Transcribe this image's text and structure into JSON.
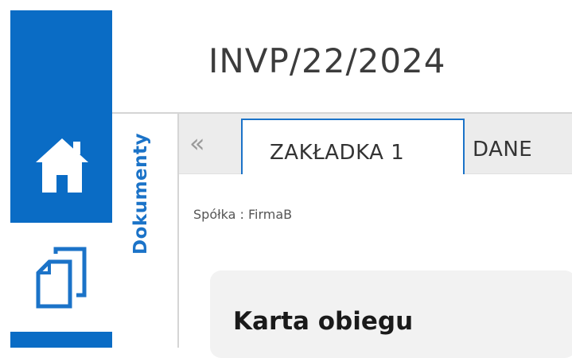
{
  "header": {
    "title": "INVP/22/2024"
  },
  "sidebar": {
    "items": [
      {
        "icon": "home-icon"
      },
      {
        "icon": "documents-icon"
      }
    ],
    "panel_label": "Dokumenty"
  },
  "tabs": {
    "collapse_icon": "«",
    "items": [
      {
        "label": "ZAKŁADKA 1"
      },
      {
        "label": "DANE"
      }
    ]
  },
  "content": {
    "company": "Spółka : FirmaB",
    "card_title": "Karta obiegu"
  },
  "colors": {
    "accent": "#0a6cc5",
    "text": "#333333"
  }
}
